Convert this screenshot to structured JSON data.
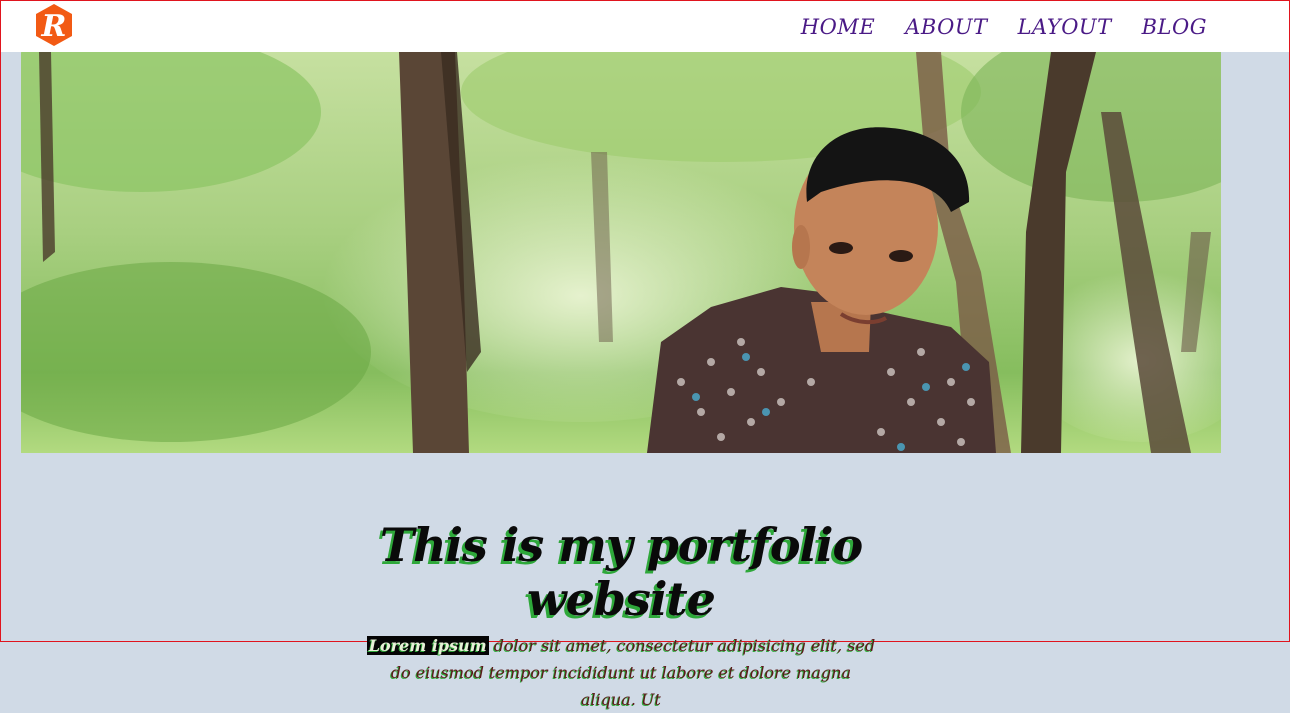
{
  "nav": {
    "items": [
      {
        "label": "HOME"
      },
      {
        "label": "ABOUT"
      },
      {
        "label": "LAYOUT"
      },
      {
        "label": "BLOG"
      }
    ]
  },
  "logo": {
    "letter": "R",
    "color": "#f25a14"
  },
  "intro": {
    "title": "This is my portfolio website",
    "highlight": "Lorem ipsum",
    "text": "dolor sit amet, consectetur adipisicing elit, sed do eiusmod tempor incididunt ut labore et dolore magna aliqua. Ut"
  },
  "colors": {
    "background": "#d0dae6",
    "nav_text": "#4a1a86",
    "title_shadow": "#2ea83a"
  }
}
